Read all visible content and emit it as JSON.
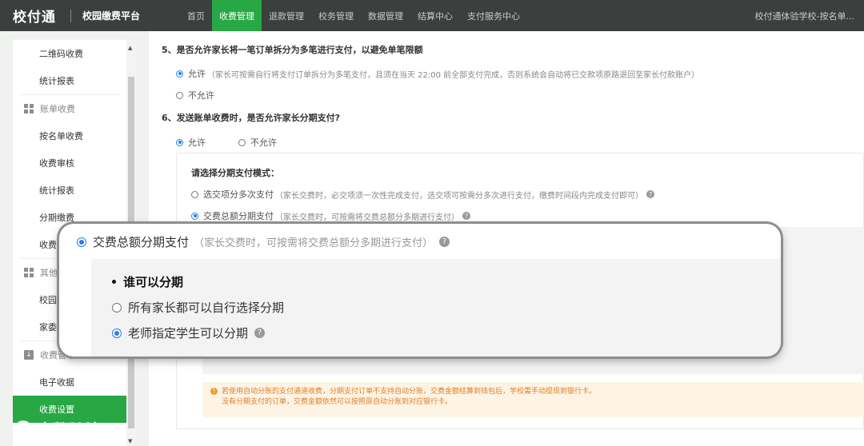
{
  "topbar": {
    "logo": "校付通",
    "platform": "校园缴费平台",
    "nav": [
      "首页",
      "收费管理",
      "退款管理",
      "校务管理",
      "数据管理",
      "结算中心",
      "支付服务中心"
    ],
    "active_nav": "收费管理",
    "account": "校付通体验学校-按名单..."
  },
  "sidebar": {
    "items": [
      {
        "type": "item",
        "label": "二维码收费"
      },
      {
        "type": "item",
        "label": "统计报表"
      },
      {
        "type": "group",
        "label": "账单收费"
      },
      {
        "type": "item",
        "label": "按名单收费"
      },
      {
        "type": "item",
        "label": "收费审核"
      },
      {
        "type": "item",
        "label": "统计报表"
      },
      {
        "type": "item",
        "label": "分期缴费"
      },
      {
        "type": "item",
        "label": "收费"
      },
      {
        "type": "group",
        "label": "其他"
      },
      {
        "type": "item",
        "label": "校园"
      },
      {
        "type": "item",
        "label": "家委"
      },
      {
        "type": "group",
        "label": "收费管理"
      },
      {
        "type": "item",
        "label": "电子收据"
      },
      {
        "type": "item",
        "label": "收费设置",
        "active": true
      }
    ]
  },
  "main": {
    "q5": {
      "title": "5、是否允许家长将一笔订单拆分为多笔进行支付，以避免单笔限额",
      "opt_allow": "允许",
      "opt_allow_hint": "（家长可按需自行将支付订单拆分为多笔支付，且须在当天 22:00 前全部支付完成，否则系统会自动将已交款项原路退回至家长付款账户）",
      "opt_deny": "不允许",
      "selected": "允许"
    },
    "q6": {
      "title": "6、发送账单收费时，是否允许家长分期支付?",
      "opt_allow": "允许",
      "opt_deny": "不允许",
      "selected": "允许"
    },
    "mode": {
      "title": "请选择分期支付模式：",
      "opt1": "选交项分多次支付",
      "opt1_hint": "（家长交费时，必交项须一次性完成支付，选交项可按需分多次进行支付，缴费时间段内完成支付即可）",
      "opt2": "交费总额分期支付",
      "opt2_hint": "（家长交费时，可按需将交费总额分多期进行支付）",
      "selected": "交费总额分期支付"
    },
    "warning": {
      "line1": "若使用自动分账的支付通道收费，分期支付订单不支持自动分账，交费金额结算到钱包后，学校需手动提现到银行卡。",
      "line2": "没有分期支付的订单，交费金额依然可以按照原自动分账到对应银行卡。"
    }
  },
  "zoom": {
    "option": "交费总额分期支付",
    "hint": "（家长交费时，可按需将交费总额分多期进行支付）",
    "who_title": "谁可以分期",
    "who_opt1": "所有家长都可以自行选择分期",
    "who_opt2": "老师指定学生可以分期",
    "who_selected": "老师指定学生可以分期"
  },
  "watermark": "大数跨境",
  "colors": {
    "accent": "#27a844",
    "radio": "#2b7de9",
    "topbar": "#3b3f3d",
    "warning": "#e37e1f"
  }
}
